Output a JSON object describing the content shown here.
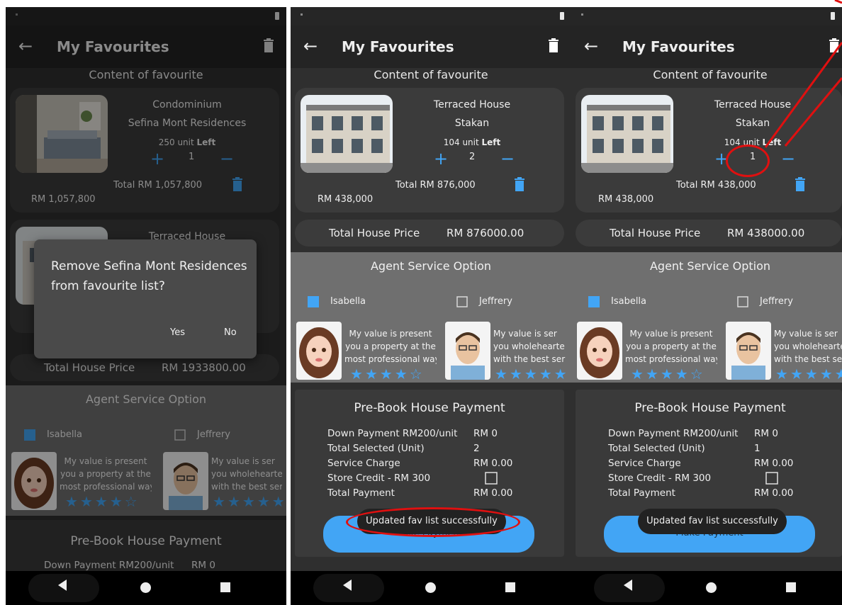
{
  "app": {
    "title": "My Favourites"
  },
  "screens": [
    {
      "section_title": "Content of favourite",
      "card1": {
        "type": "Condominium",
        "name": "Sefina Mont Residences",
        "units_left": "250 unit",
        "units_left_suffix": "Left",
        "qty": "1",
        "total": "Total RM 1,057,800",
        "price": "RM 1,057,800"
      },
      "card2": {
        "type": "Terraced House"
      },
      "total_house_label": "Total House Price",
      "total_house_value": "RM 1933800.00",
      "agent_title": "Agent Service Option",
      "agent1": {
        "name": "Isabella",
        "desc1": "My value is present",
        "desc2": "you a property at the",
        "desc3": "most professional way.",
        "rating": 4
      },
      "agent2": {
        "name": "Jeffrery",
        "desc1": "My value is ser",
        "desc2": "you wholehearte",
        "desc3": "with the best ser",
        "rating": 5
      },
      "pay_title": "Pre-Book House Payment",
      "pay_row1_label": "Down Payment RM200/unit",
      "pay_row1_value": "RM 0",
      "dialog": {
        "text": "Remove Sefina Mont Residences from favourite list?",
        "yes": "Yes",
        "no": "No"
      }
    },
    {
      "section_title": "Content of favourite",
      "card": {
        "type": "Terraced House",
        "name": "Stakan",
        "units_left": "104 unit",
        "units_left_suffix": "Left",
        "qty": "2",
        "total": "Total RM 876,000",
        "price": "RM 438,000"
      },
      "total_house_label": "Total House Price",
      "total_house_value": "RM 876000.00",
      "agent_title": "Agent Service Option",
      "agent1": {
        "name": "Isabella",
        "desc1": "My value is present",
        "desc2": "you a property at the",
        "desc3": "most professional way.",
        "rating": 4
      },
      "agent2": {
        "name": "Jeffrery",
        "desc1": "My value is ser",
        "desc2": "you wholehearte",
        "desc3": "with the best ser",
        "rating": 5
      },
      "pay_title": "Pre-Book House Payment",
      "pay_rows": [
        {
          "label": "Down Payment RM200/unit",
          "value": "RM 0"
        },
        {
          "label": "Total Selected (Unit)",
          "value": "2"
        },
        {
          "label": "Service Charge",
          "value": "RM 0.00"
        },
        {
          "label": "Store Credit - RM 300",
          "value": ""
        },
        {
          "label": "Total Payment",
          "value": "RM 0.00"
        }
      ],
      "pay_button": "Make Payment",
      "toast": "Updated fav list successfully"
    },
    {
      "section_title": "Content of favourite",
      "card": {
        "type": "Terraced House",
        "name": "Stakan",
        "units_left": "104 unit",
        "units_left_suffix": "Left",
        "qty": "1",
        "total": "Total RM 438,000",
        "price": "RM 438,000"
      },
      "total_house_label": "Total House Price",
      "total_house_value": "RM 438000.00",
      "agent_title": "Agent Service Option",
      "agent1": {
        "name": "Isabella",
        "desc1": "My value is present",
        "desc2": "you a property at the",
        "desc3": "most professional way.",
        "rating": 4
      },
      "agent2": {
        "name": "Jeffrery",
        "desc1": "My value is ser",
        "desc2": "you wholehearte",
        "desc3": "with the best ser",
        "rating": 5
      },
      "pay_title": "Pre-Book House Payment",
      "pay_rows": [
        {
          "label": "Down Payment RM200/unit",
          "value": "RM 0"
        },
        {
          "label": "Total Selected (Unit)",
          "value": "1"
        },
        {
          "label": "Service Charge",
          "value": "RM 0.00"
        },
        {
          "label": "Store Credit - RM 300",
          "value": ""
        },
        {
          "label": "Total Payment",
          "value": "RM 0.00"
        }
      ],
      "pay_button": "Make Payment",
      "toast": "Updated fav list successfully"
    }
  ],
  "colors": {
    "accent": "#42a5f5",
    "annotation": "#e01010",
    "background": "#2f2f2f"
  },
  "icons": [
    "back-arrow-icon",
    "trash-icon",
    "plus-icon",
    "minus-icon",
    "star-icon",
    "checkbox-icon",
    "nav-back-icon",
    "nav-home-icon",
    "nav-recent-icon"
  ]
}
